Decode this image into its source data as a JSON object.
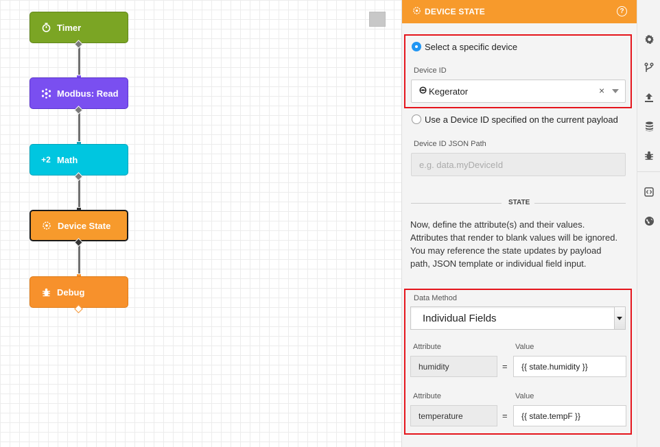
{
  "canvas": {
    "nodes": [
      {
        "label": "Timer",
        "icon": "timer-icon",
        "color": "#7ba524"
      },
      {
        "label": "Modbus: Read",
        "icon": "modbus-icon",
        "color": "#7a4ff0"
      },
      {
        "label": "Math",
        "icon": "math-icon",
        "icon_text": "+2",
        "color": "#00c6e0"
      },
      {
        "label": "Device State",
        "icon": "device-state-icon",
        "color": "#f79a2c"
      },
      {
        "label": "Debug",
        "icon": "bug-icon",
        "color": "#f7912c"
      }
    ]
  },
  "panel": {
    "title": "DEVICE STATE",
    "help_icon": "?",
    "option_specific": "Select a specific device",
    "device_id_label": "Device ID",
    "device_id_value": "Kegerator",
    "clear_symbol": "×",
    "option_payload": "Use a Device ID specified on the current payload",
    "json_path_label": "Device ID JSON Path",
    "json_path_placeholder": "e.g. data.myDeviceId",
    "state_section": "STATE",
    "description": "Now, define the attribute(s) and their values. Attributes that render to blank values will be ignored. You may reference the state updates by payload path, JSON template or individual field input.",
    "data_method_label": "Data Method",
    "data_method_value": "Individual Fields",
    "attribute_header": "Attribute",
    "value_header": "Value",
    "equals": "=",
    "rows": [
      {
        "attribute": "humidity",
        "value": "{{ state.humidity }}"
      },
      {
        "attribute": "temperature",
        "value": "{{ state.tempF }}"
      }
    ]
  },
  "toolbar": {
    "icons": [
      "gear-icon",
      "branch-icon",
      "upload-icon",
      "database-icon",
      "bug-icon",
      "embed-icon",
      "globe-icon"
    ]
  },
  "colors": {
    "accent_orange": "#f79a2c",
    "highlight_red": "#e5141b",
    "radio_blue": "#2196f3"
  }
}
